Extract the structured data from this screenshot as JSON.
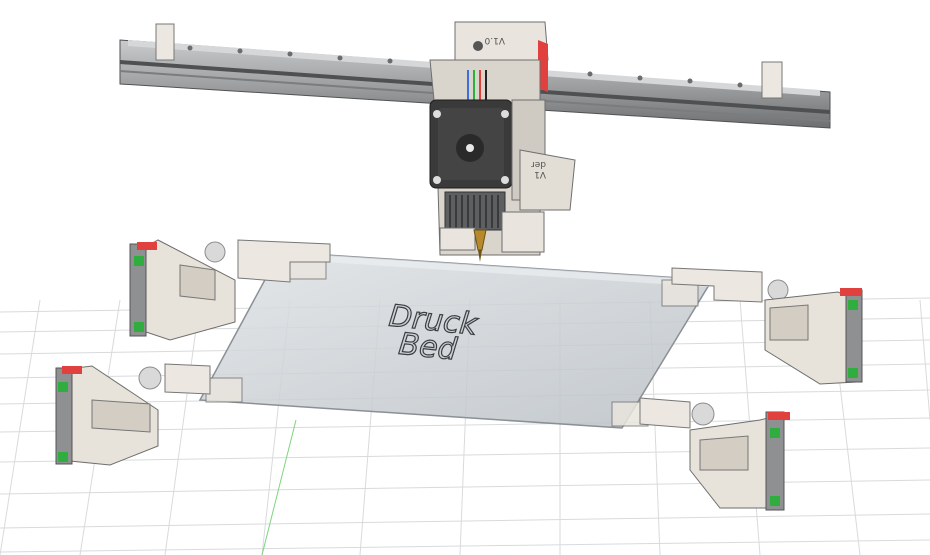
{
  "scene": {
    "bed_text_line1": "Druck",
    "bed_text_line2": "Bed",
    "carriage_label_line1": "der",
    "carriage_label_line2": "V1",
    "top_block_label": "V1.0"
  },
  "colors": {
    "background": "#ffffff",
    "grid": "#d6d8da",
    "aluminum": "#9a9c9e",
    "aluminum_dark": "#5f6163",
    "part_light": "#e7e2da",
    "part_shadow": "#c9c3b9",
    "stepper": "#3a3a3a",
    "glass": "#c7ccd0",
    "accent_red": "#e0413e",
    "accent_green": "#2fae3f"
  }
}
